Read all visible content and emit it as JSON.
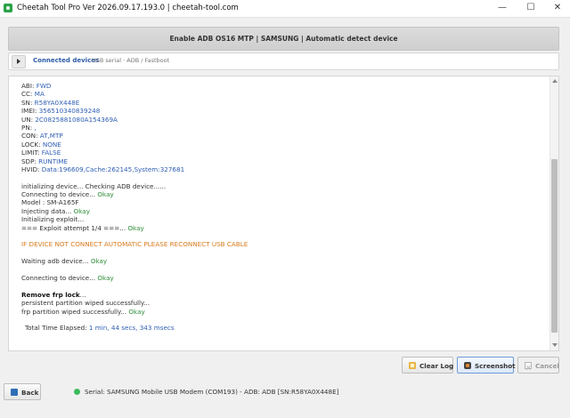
{
  "window": {
    "title": "Cheetah Tool Pro Ver 2026.09.17.193.0 | cheetah-tool.com",
    "minimize": "—",
    "maximize": "☐",
    "close": "✕"
  },
  "header": {
    "text": "Enable ADB OS16 MTP | SAMSUNG | Automatic detect device"
  },
  "tabs": {
    "active_label": "Connected devices",
    "sub_label": "USB serial · ADB / Fastboot"
  },
  "log": {
    "info": [
      {
        "key": "ABI: ",
        "value": "FWD"
      },
      {
        "key": "CC: ",
        "value": "MA"
      },
      {
        "key": "SN: ",
        "value": "R58YA0X448E"
      },
      {
        "key": "IMEI: ",
        "value": "356510340839248"
      },
      {
        "key": "UN: ",
        "value": "2C0825881080A154369A"
      },
      {
        "key": "PN: ",
        "value": ","
      },
      {
        "key": "CON: ",
        "value": "AT,MTP"
      },
      {
        "key": "LOCK: ",
        "value": "NONE"
      },
      {
        "key": "LIMIT: ",
        "value": "FALSE"
      },
      {
        "key": "SDP: ",
        "value": "RUNTIME"
      },
      {
        "key": "HVID: ",
        "value": "Data:196609,Cache:262145,System:327681"
      }
    ],
    "init": [
      {
        "text": "initializing device... Checking ADB device......",
        "ok": ""
      },
      {
        "text": "Connecting to device... ",
        "ok": "Okay"
      },
      {
        "text": "Model : SM-A165F",
        "ok": ""
      },
      {
        "text": "Injecting data... ",
        "ok": "Okay"
      },
      {
        "text": "Initializing exploit...",
        "ok": ""
      },
      {
        "text": "=== Exploit attempt 1/4 ===... ",
        "ok": "Okay"
      }
    ],
    "warning": "IF DEVICE NOT CONNECT AUTOMATIC PLEASE RECONNECT USB CABLE",
    "waiting": {
      "text": "Waiting adb device... ",
      "ok": "Okay"
    },
    "connecting": {
      "text": "Connecting to device... ",
      "ok": "Okay"
    },
    "remove_title": "Remove frp lock",
    "remove_dots": "...",
    "persistent": "persistent partition wiped successfully...",
    "frp": {
      "text": "frp partition wiped successfully... ",
      "ok": "Okay"
    },
    "elapsed_label": "Total Time Elapsed: ",
    "elapsed_value": "1 min, 44 secs, 343 msecs"
  },
  "buttons": {
    "clear_log": "Clear Log",
    "screenshot": "Screenshot",
    "cancel": "Cancel",
    "back": "Back"
  },
  "status": {
    "text": "Serial: SAMSUNG Mobile USB Modem (COM193)  -  ADB: ADB [SN:R58YA0X448E]",
    "color": "#3dbb5d"
  },
  "colors": {
    "value_blue": "#2f5fb3",
    "okay_green": "#2f8f3a",
    "warning_orange": "#d97a1c"
  }
}
